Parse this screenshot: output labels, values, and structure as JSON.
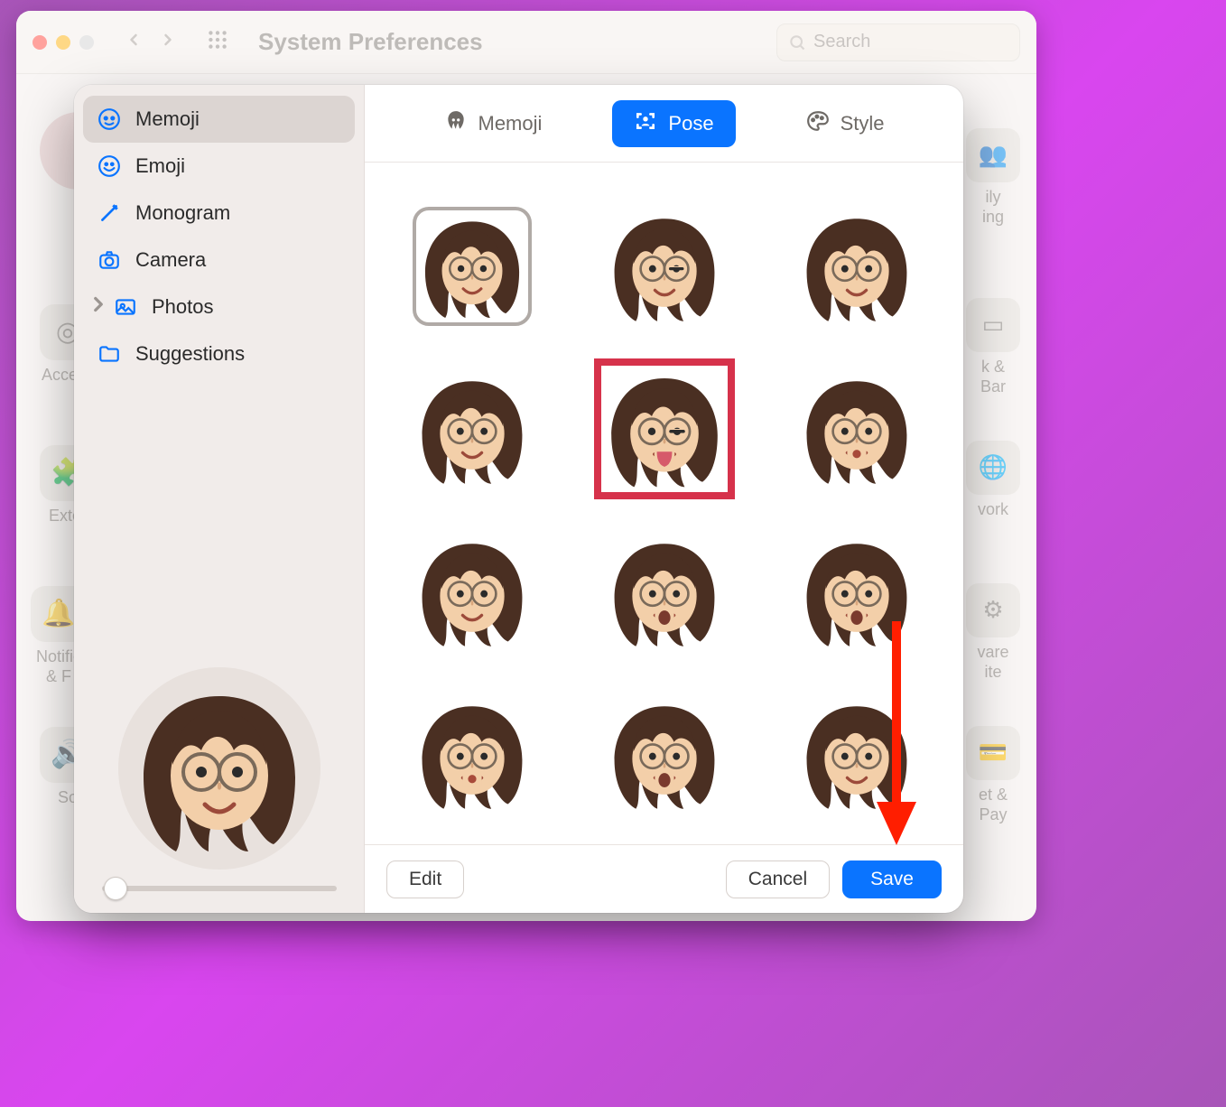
{
  "window": {
    "title": "System Preferences",
    "search_placeholder": "Search"
  },
  "sidebar": {
    "items": [
      {
        "label": "Memoji",
        "icon": "memoji-icon"
      },
      {
        "label": "Emoji",
        "icon": "emoji-icon"
      },
      {
        "label": "Monogram",
        "icon": "monogram-icon"
      },
      {
        "label": "Camera",
        "icon": "camera-icon"
      },
      {
        "label": "Photos",
        "icon": "photos-icon"
      },
      {
        "label": "Suggestions",
        "icon": "folder-icon"
      }
    ],
    "active_index": 0
  },
  "tabs": {
    "items": [
      {
        "label": "Memoji",
        "icon": "memoji-head-icon"
      },
      {
        "label": "Pose",
        "icon": "pose-frame-icon"
      },
      {
        "label": "Style",
        "icon": "palette-icon"
      }
    ],
    "active_index": 1
  },
  "footer": {
    "edit_label": "Edit",
    "cancel_label": "Cancel",
    "save_label": "Save"
  },
  "poses": {
    "count": 12,
    "selected_index": 0,
    "highlighted_index": 4
  },
  "zoom": {
    "value": 0
  },
  "background_items_left": [
    {
      "label": "Access"
    },
    {
      "label": "Exter"
    },
    {
      "label": "Notific\n& F"
    },
    {
      "label": "So"
    }
  ],
  "background_items_right": [
    {
      "label": "ily\ning"
    },
    {
      "label": "k &\nBar"
    },
    {
      "label": "vork"
    },
    {
      "label": "vare\nite"
    },
    {
      "label": "et &\nPay"
    }
  ]
}
